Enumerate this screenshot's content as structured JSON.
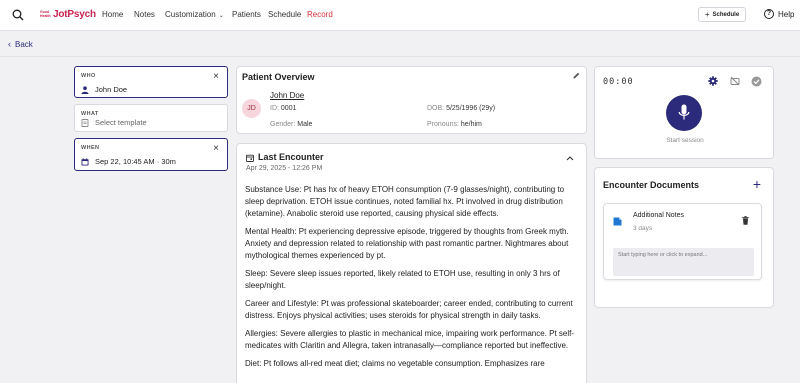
{
  "nav": {
    "logo_small": "Good Health",
    "logo": "JotPsych",
    "items": [
      "Home",
      "Notes",
      "Customization",
      "Patients",
      "Schedule",
      "Record"
    ],
    "schedule_button": "Schedule",
    "help": "Help"
  },
  "back": "Back",
  "who": {
    "label": "WHO",
    "value": "John Doe"
  },
  "what": {
    "label": "WHAT",
    "placeholder": "Select template"
  },
  "when": {
    "label": "WHEN",
    "value": "Sep 22, 10:45 AM · 30m"
  },
  "patient": {
    "title": "Patient Overview",
    "initials": "JD",
    "name": "John Doe",
    "id_label": "ID:",
    "id": "0001",
    "dob_label": "DOB:",
    "dob": "5/25/1996 (29y)",
    "gender_label": "Gender:",
    "gender": "Male",
    "pronouns_label": "Pronouns:",
    "pronouns": "he/him"
  },
  "encounter": {
    "title": "Last Encounter",
    "date": "Apr 29, 2025 - 12:26 PM",
    "paragraphs": [
      "Substance Use: Pt has hx of heavy ETOH consumption (7-9 glasses/night), contributing to sleep deprivation. ETOH issue continues, noted familial hx. Pt involved in drug distribution (ketamine). Anabolic steroid use reported, causing physical side effects.",
      "Mental Health: Pt experiencing depressive episode, triggered by thoughts from Greek myth. Anxiety and depression related to relationship with past romantic partner. Nightmares about mythological themes experienced by pt.",
      "Sleep: Severe sleep issues reported, likely related to ETOH use, resulting in only 3 hrs of sleep/night.",
      "Career and Lifestyle: Pt was professional skateboarder; career ended, contributing to current distress. Enjoys physical activities; uses steroids for physical strength in daily tasks.",
      "Allergies: Severe allergies to plastic in mechanical mice, impairing work performance. Pt self-medicates with Claritin and Allegra, taken intranasally—compliance reported but ineffective.",
      "Diet: Pt follows all-red meat diet; claims no vegetable consumption. Emphasizes rare"
    ]
  },
  "recorder": {
    "timer": "00:00",
    "start_label": "Start session"
  },
  "documents": {
    "title": "Encounter Documents",
    "note_title": "Additional Notes",
    "note_age": "3 days",
    "note_placeholder": "Start typing here or click to expand..."
  },
  "colors": {
    "brand": "#c7254e",
    "accent": "#2c2a7a",
    "record": "#d8323a"
  }
}
